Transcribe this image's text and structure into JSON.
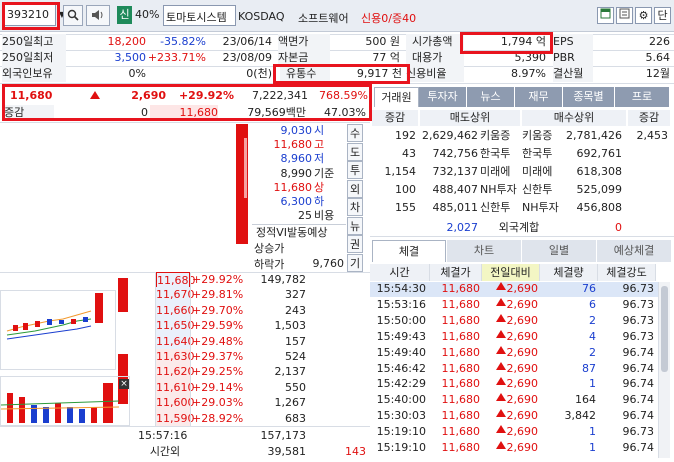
{
  "toolbar": {
    "code": "393210",
    "shin": "신",
    "margin": "40%",
    "company": "토마토시스템",
    "market": "KOSDAQ",
    "sector": "소프트웨어",
    "credit": "신용0/증40",
    "icon_search": "search-icon",
    "icon_sound": "speaker-icon",
    "icon_single": "단"
  },
  "info": {
    "r1": {
      "label": "250일최고",
      "price": "18,200",
      "pct": "-35.82%",
      "date": "23/06/14",
      "l2": "액면가",
      "v2": "500 원",
      "l3": "시가총액",
      "v3": "1,794 억",
      "l4": "EPS",
      "v4": "226"
    },
    "r2": {
      "label": "250일최저",
      "price": "3,500",
      "pct": "+233.71%",
      "date": "23/08/09",
      "l2": "자본금",
      "v2": "77 억",
      "l3": "대용가",
      "v3": "5,390",
      "l4": "PBR",
      "v4": "5.64"
    },
    "r3": {
      "label": "외국인보유",
      "pct": "0%",
      "unit": "0(천)",
      "l2": "유통수",
      "v2": "9,917 천",
      "l3": "신용비율",
      "v3": "8.97%",
      "l4": "결산월",
      "v4": "12월"
    }
  },
  "price": {
    "current": "11,680",
    "change": "2,690",
    "pct": "+29.92%",
    "volume": "7,222,341",
    "vol_ratio": "768.59%",
    "label_inc": "증감",
    "inc": "0",
    "price2": "11,680",
    "amount": "79,569백만",
    "ratio2": "47.03%"
  },
  "right_tabs": [
    "거래원",
    "투자자",
    "뉴스",
    "재무",
    "종목별",
    "프로"
  ],
  "broker": {
    "h_inc": "증감",
    "h_sell": "매도상위",
    "h_buy": "매수상위",
    "h_inc2": "증감",
    "rows": [
      {
        "inc": "192",
        "sell": "2,629,462",
        "sname": "키움증",
        "bname": "키움증",
        "buy": "2,781,426",
        "inc2": "2,453"
      },
      {
        "inc": "43",
        "sell": "742,756",
        "sname": "한국투",
        "bname": "한국투",
        "buy": "692,761",
        "inc2": ""
      },
      {
        "inc": "1,154",
        "sell": "732,137",
        "sname": "미래에",
        "bname": "미래에",
        "buy": "618,308",
        "inc2": ""
      },
      {
        "inc": "100",
        "sell": "488,407",
        "sname": "NH투자",
        "bname": "신한투",
        "buy": "525,099",
        "inc2": ""
      },
      {
        "inc": "155",
        "sell": "485,011",
        "sname": "신한투",
        "bname": "NH투자",
        "buy": "456,808",
        "inc2": ""
      }
    ],
    "foreign_sell": "2,027",
    "foreign_label": "외국계합",
    "foreign_buy": "0"
  },
  "summary": [
    {
      "v": "9,030",
      "k": "시"
    },
    {
      "v": "11,680",
      "k": "고"
    },
    {
      "v": "8,960",
      "k": "저"
    },
    {
      "v": "8,990",
      "k": "기준"
    },
    {
      "v": "11,680",
      "k": "상"
    },
    {
      "v": "6,300",
      "k": "하"
    },
    {
      "v": "25",
      "k": "비용"
    }
  ],
  "vi": {
    "title": "정적VI발동예상",
    "up": "상승가",
    "down": "하락가",
    "down_v": "9,760"
  },
  "vtabs": [
    "수",
    "도",
    "투",
    "외",
    "차",
    "뉴",
    "권",
    "기"
  ],
  "orderbook": [
    {
      "p": "11,680",
      "pct": "+29.92%",
      "q": "149,782"
    },
    {
      "p": "11,670",
      "pct": "+29.81%",
      "q": "327"
    },
    {
      "p": "11,660",
      "pct": "+29.70%",
      "q": "243"
    },
    {
      "p": "11,650",
      "pct": "+29.59%",
      "q": "1,503"
    },
    {
      "p": "11,640",
      "pct": "+29.48%",
      "q": "157"
    },
    {
      "p": "11,630",
      "pct": "+29.37%",
      "q": "524"
    },
    {
      "p": "11,620",
      "pct": "+29.25%",
      "q": "2,137"
    },
    {
      "p": "11,610",
      "pct": "+29.14%",
      "q": "550"
    },
    {
      "p": "11,600",
      "pct": "+29.03%",
      "q": "1,267"
    },
    {
      "p": "11,590",
      "pct": "+28.92%",
      "q": "683"
    }
  ],
  "ob_footer": {
    "time": "15:57:16",
    "time_label": "시간외",
    "total1": "157,173",
    "total2": "39,581",
    "extra": "143"
  },
  "bottom_tabs": [
    "체결",
    "차트",
    "일별",
    "예상체결"
  ],
  "fills_head": [
    "시간",
    "체결가",
    "전일대비",
    "체결량",
    "체결강도"
  ],
  "fills": [
    {
      "t": "15:54:30",
      "p": "11,680",
      "d": "2,690",
      "q": "76",
      "s": "96.73",
      "qc": "blue"
    },
    {
      "t": "15:53:16",
      "p": "11,680",
      "d": "2,690",
      "q": "6",
      "s": "96.73",
      "qc": "blue"
    },
    {
      "t": "15:50:00",
      "p": "11,680",
      "d": "2,690",
      "q": "2",
      "s": "96.73",
      "qc": "blue"
    },
    {
      "t": "15:49:43",
      "p": "11,680",
      "d": "2,690",
      "q": "4",
      "s": "96.73",
      "qc": "blue"
    },
    {
      "t": "15:49:40",
      "p": "11,680",
      "d": "2,690",
      "q": "2",
      "s": "96.74",
      "qc": "blue"
    },
    {
      "t": "15:46:42",
      "p": "11,680",
      "d": "2,690",
      "q": "87",
      "s": "96.74",
      "qc": "blue"
    },
    {
      "t": "15:42:29",
      "p": "11,680",
      "d": "2,690",
      "q": "1",
      "s": "96.74",
      "qc": "blue"
    },
    {
      "t": "15:40:00",
      "p": "11,680",
      "d": "2,690",
      "q": "164",
      "s": "96.74",
      "qc": "black"
    },
    {
      "t": "15:30:03",
      "p": "11,680",
      "d": "2,690",
      "q": "3,842",
      "s": "96.74",
      "qc": "black"
    },
    {
      "t": "15:19:10",
      "p": "11,680",
      "d": "2,690",
      "q": "1",
      "s": "96.73",
      "qc": "blue"
    },
    {
      "t": "15:19:10",
      "p": "11,680",
      "d": "2,690",
      "q": "1",
      "s": "96.74",
      "qc": "blue"
    }
  ],
  "colors": {
    "up": "#e01010",
    "down": "#1a3ecf",
    "highlight": "#e8141e",
    "tab_bg": "#8e9bb0"
  }
}
